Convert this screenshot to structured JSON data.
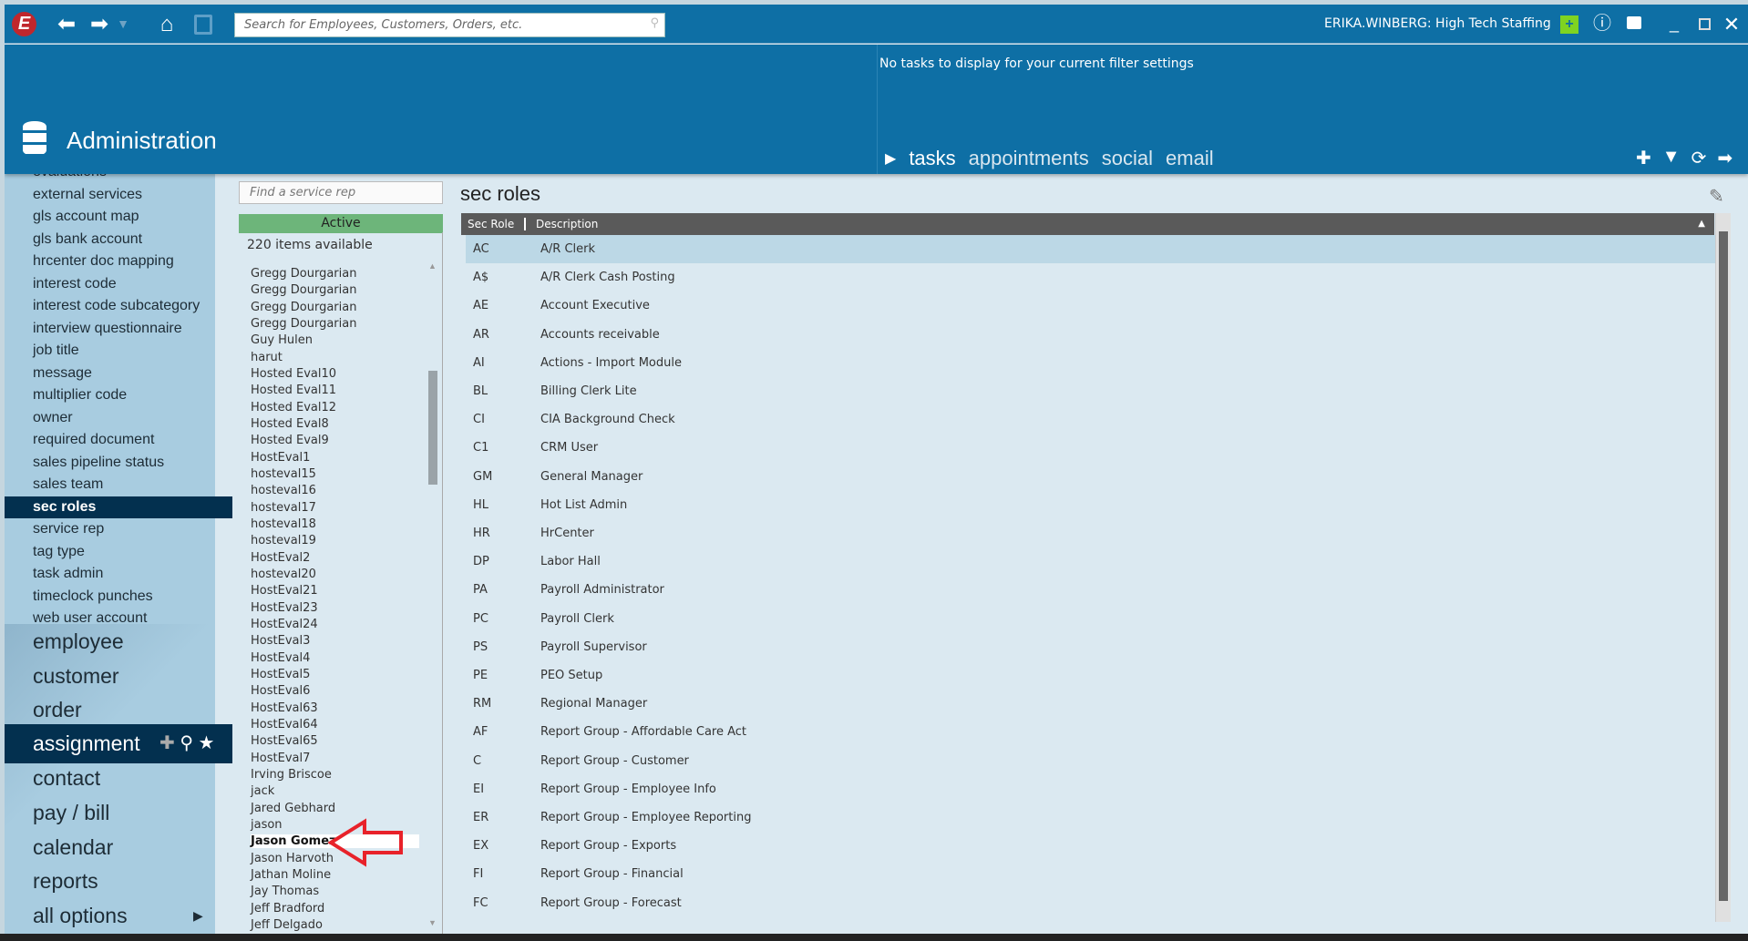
{
  "topbar": {
    "search_placeholder": "Search for Employees, Customers, Orders, etc.",
    "user": "ERIKA.WINBERG: High Tech Staffing",
    "logo": "E"
  },
  "header": {
    "title": "Administration",
    "tasks_message": "No tasks to display for your current filter settings",
    "tabs": [
      "tasks",
      "appointments",
      "social",
      "email"
    ]
  },
  "sidebar": {
    "items": [
      "evaluations",
      "external services",
      "gls account map",
      "gls bank account",
      "hrcenter doc mapping",
      "interest code",
      "interest code subcategory",
      "interview questionnaire",
      "job title",
      "message",
      "multiplier code",
      "owner",
      "required document",
      "sales pipeline status",
      "sales team",
      "sec roles",
      "service rep",
      "tag type",
      "task admin",
      "timeclock punches",
      "web user account"
    ],
    "selected": "sec roles",
    "nav": [
      "employee",
      "customer",
      "order",
      "assignment",
      "contact",
      "pay / bill",
      "calendar",
      "reports",
      "all options"
    ],
    "nav_selected": "assignment"
  },
  "list": {
    "search_placeholder": "Find a service rep",
    "filter": "Active",
    "count": "220 items available",
    "selected": "Jason Gomez",
    "items": [
      "Gregg Dourgarian",
      "Gregg Dourgarian",
      "Gregg Dourgarian",
      "Gregg Dourgarian",
      "Guy Hulen",
      "harut",
      "Hosted Eval10",
      "Hosted Eval11",
      "Hosted Eval12",
      "Hosted Eval8",
      "Hosted Eval9",
      "HostEval1",
      "hosteval15",
      "hosteval16",
      "hosteval17",
      "hosteval18",
      "hosteval19",
      "HostEval2",
      "hosteval20",
      "HostEval21",
      "HostEval23",
      "HostEval24",
      "HostEval3",
      "HostEval4",
      "HostEval5",
      "HostEval6",
      "HostEval63",
      "HostEval64",
      "HostEval65",
      "HostEval7",
      "Irving Briscoe",
      "jack",
      "Jared Gebhard",
      "jason",
      "Jason Gomez",
      "Jason Harvoth",
      "Jathan Moline",
      "Jay Thomas",
      "Jeff Bradford",
      "Jeff Delgado"
    ]
  },
  "main": {
    "title": "sec roles",
    "columns": [
      "Sec Role",
      "Description"
    ],
    "rows": [
      [
        "AC",
        "A/R Clerk"
      ],
      [
        "A$",
        "A/R Clerk Cash Posting"
      ],
      [
        "AE",
        "Account Executive"
      ],
      [
        "AR",
        "Accounts receivable"
      ],
      [
        "AI",
        "Actions - Import Module"
      ],
      [
        "BL",
        "Billing Clerk Lite"
      ],
      [
        "CI",
        "CIA Background Check"
      ],
      [
        "C1",
        "CRM User"
      ],
      [
        "GM",
        "General Manager"
      ],
      [
        "HL",
        "Hot List Admin"
      ],
      [
        "HR",
        "HrCenter"
      ],
      [
        "DP",
        "Labor Hall"
      ],
      [
        "PA",
        "Payroll Administrator"
      ],
      [
        "PC",
        "Payroll Clerk"
      ],
      [
        "PS",
        "Payroll Supervisor"
      ],
      [
        "PE",
        "PEO Setup"
      ],
      [
        "RM",
        "Regional Manager"
      ],
      [
        "AF",
        "Report Group - Affordable Care Act"
      ],
      [
        "C",
        "Report Group - Customer"
      ],
      [
        "EI",
        "Report Group - Employee Info"
      ],
      [
        "ER",
        "Report Group - Employee Reporting"
      ],
      [
        "EX",
        "Report Group - Exports"
      ],
      [
        "FI",
        "Report Group - Financial"
      ],
      [
        "FC",
        "Report Group - Forecast"
      ]
    ]
  },
  "colors": {
    "brand": "#0e6fa5",
    "selected": "#03304f",
    "active": "#6db57a",
    "annotation": "#e8222a"
  }
}
